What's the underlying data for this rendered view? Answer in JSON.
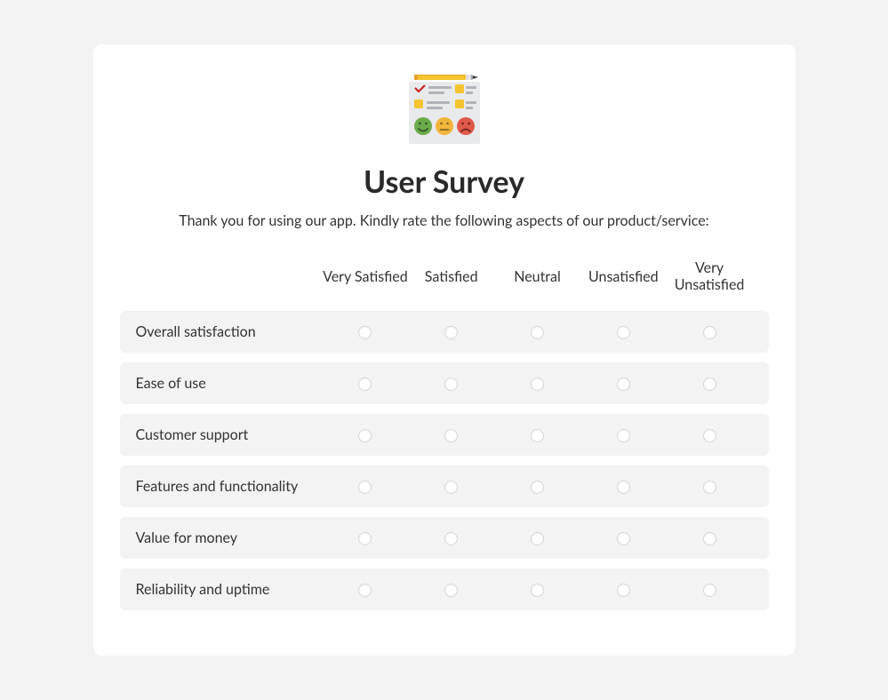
{
  "header": {
    "title": "User Survey",
    "subtitle": "Thank you for using our app. Kindly rate the following aspects of our product/service:"
  },
  "scale": {
    "columns": [
      "Very Satisfied",
      "Satisfied",
      "Neutral",
      "Unsatisfied",
      "Very Unsatisfied"
    ]
  },
  "questions": [
    {
      "label": "Overall satisfaction"
    },
    {
      "label": "Ease of use"
    },
    {
      "label": "Customer support"
    },
    {
      "label": "Features and functionality"
    },
    {
      "label": "Value for money"
    },
    {
      "label": "Reliability and uptime"
    }
  ]
}
